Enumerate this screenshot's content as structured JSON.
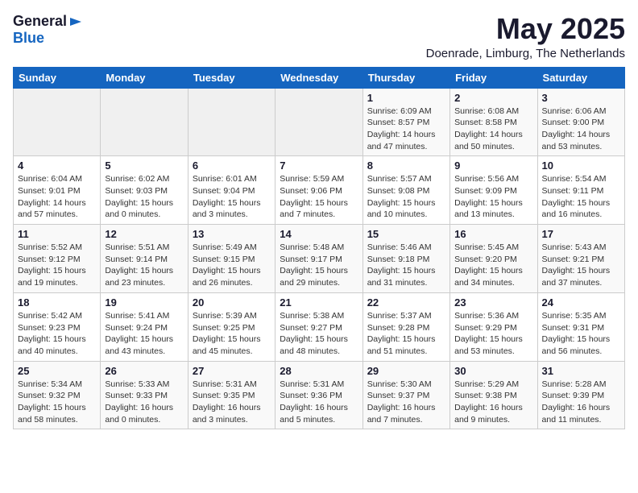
{
  "logo": {
    "general": "General",
    "blue": "Blue"
  },
  "header": {
    "month_title": "May 2025",
    "location": "Doenrade, Limburg, The Netherlands"
  },
  "weekdays": [
    "Sunday",
    "Monday",
    "Tuesday",
    "Wednesday",
    "Thursday",
    "Friday",
    "Saturday"
  ],
  "weeks": [
    [
      {
        "day": "",
        "info": ""
      },
      {
        "day": "",
        "info": ""
      },
      {
        "day": "",
        "info": ""
      },
      {
        "day": "",
        "info": ""
      },
      {
        "day": "1",
        "info": "Sunrise: 6:09 AM\nSunset: 8:57 PM\nDaylight: 14 hours and 47 minutes."
      },
      {
        "day": "2",
        "info": "Sunrise: 6:08 AM\nSunset: 8:58 PM\nDaylight: 14 hours and 50 minutes."
      },
      {
        "day": "3",
        "info": "Sunrise: 6:06 AM\nSunset: 9:00 PM\nDaylight: 14 hours and 53 minutes."
      }
    ],
    [
      {
        "day": "4",
        "info": "Sunrise: 6:04 AM\nSunset: 9:01 PM\nDaylight: 14 hours and 57 minutes."
      },
      {
        "day": "5",
        "info": "Sunrise: 6:02 AM\nSunset: 9:03 PM\nDaylight: 15 hours and 0 minutes."
      },
      {
        "day": "6",
        "info": "Sunrise: 6:01 AM\nSunset: 9:04 PM\nDaylight: 15 hours and 3 minutes."
      },
      {
        "day": "7",
        "info": "Sunrise: 5:59 AM\nSunset: 9:06 PM\nDaylight: 15 hours and 7 minutes."
      },
      {
        "day": "8",
        "info": "Sunrise: 5:57 AM\nSunset: 9:08 PM\nDaylight: 15 hours and 10 minutes."
      },
      {
        "day": "9",
        "info": "Sunrise: 5:56 AM\nSunset: 9:09 PM\nDaylight: 15 hours and 13 minutes."
      },
      {
        "day": "10",
        "info": "Sunrise: 5:54 AM\nSunset: 9:11 PM\nDaylight: 15 hours and 16 minutes."
      }
    ],
    [
      {
        "day": "11",
        "info": "Sunrise: 5:52 AM\nSunset: 9:12 PM\nDaylight: 15 hours and 19 minutes."
      },
      {
        "day": "12",
        "info": "Sunrise: 5:51 AM\nSunset: 9:14 PM\nDaylight: 15 hours and 23 minutes."
      },
      {
        "day": "13",
        "info": "Sunrise: 5:49 AM\nSunset: 9:15 PM\nDaylight: 15 hours and 26 minutes."
      },
      {
        "day": "14",
        "info": "Sunrise: 5:48 AM\nSunset: 9:17 PM\nDaylight: 15 hours and 29 minutes."
      },
      {
        "day": "15",
        "info": "Sunrise: 5:46 AM\nSunset: 9:18 PM\nDaylight: 15 hours and 31 minutes."
      },
      {
        "day": "16",
        "info": "Sunrise: 5:45 AM\nSunset: 9:20 PM\nDaylight: 15 hours and 34 minutes."
      },
      {
        "day": "17",
        "info": "Sunrise: 5:43 AM\nSunset: 9:21 PM\nDaylight: 15 hours and 37 minutes."
      }
    ],
    [
      {
        "day": "18",
        "info": "Sunrise: 5:42 AM\nSunset: 9:23 PM\nDaylight: 15 hours and 40 minutes."
      },
      {
        "day": "19",
        "info": "Sunrise: 5:41 AM\nSunset: 9:24 PM\nDaylight: 15 hours and 43 minutes."
      },
      {
        "day": "20",
        "info": "Sunrise: 5:39 AM\nSunset: 9:25 PM\nDaylight: 15 hours and 45 minutes."
      },
      {
        "day": "21",
        "info": "Sunrise: 5:38 AM\nSunset: 9:27 PM\nDaylight: 15 hours and 48 minutes."
      },
      {
        "day": "22",
        "info": "Sunrise: 5:37 AM\nSunset: 9:28 PM\nDaylight: 15 hours and 51 minutes."
      },
      {
        "day": "23",
        "info": "Sunrise: 5:36 AM\nSunset: 9:29 PM\nDaylight: 15 hours and 53 minutes."
      },
      {
        "day": "24",
        "info": "Sunrise: 5:35 AM\nSunset: 9:31 PM\nDaylight: 15 hours and 56 minutes."
      }
    ],
    [
      {
        "day": "25",
        "info": "Sunrise: 5:34 AM\nSunset: 9:32 PM\nDaylight: 15 hours and 58 minutes."
      },
      {
        "day": "26",
        "info": "Sunrise: 5:33 AM\nSunset: 9:33 PM\nDaylight: 16 hours and 0 minutes."
      },
      {
        "day": "27",
        "info": "Sunrise: 5:31 AM\nSunset: 9:35 PM\nDaylight: 16 hours and 3 minutes."
      },
      {
        "day": "28",
        "info": "Sunrise: 5:31 AM\nSunset: 9:36 PM\nDaylight: 16 hours and 5 minutes."
      },
      {
        "day": "29",
        "info": "Sunrise: 5:30 AM\nSunset: 9:37 PM\nDaylight: 16 hours and 7 minutes."
      },
      {
        "day": "30",
        "info": "Sunrise: 5:29 AM\nSunset: 9:38 PM\nDaylight: 16 hours and 9 minutes."
      },
      {
        "day": "31",
        "info": "Sunrise: 5:28 AM\nSunset: 9:39 PM\nDaylight: 16 hours and 11 minutes."
      }
    ]
  ]
}
